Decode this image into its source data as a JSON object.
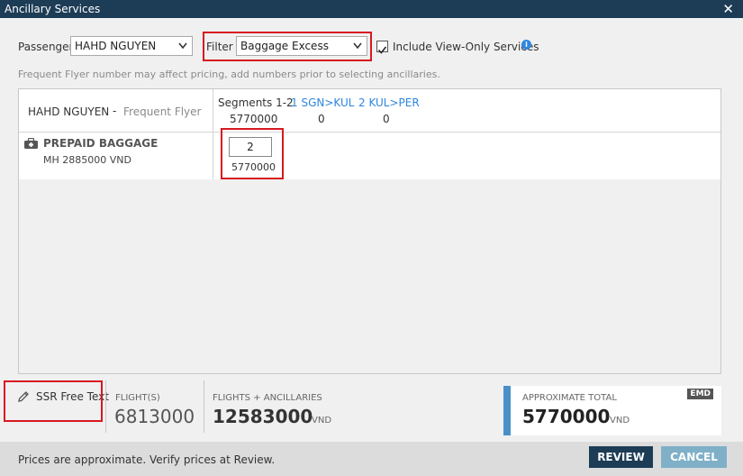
{
  "window": {
    "title": "Ancillary Services"
  },
  "toolbar": {
    "passenger_label": "Passenger",
    "passenger_value": "HAHD NGUYEN",
    "filter_label": "Filter",
    "filter_value": "Baggage Excess",
    "include_view_only_label": "Include View-Only Services",
    "include_view_only_checked": true
  },
  "note": "Frequent Flyer number may affect pricing, add numbers prior to selecting ancillaries.",
  "grid": {
    "passenger_name": "HAHD NGUYEN",
    "dash": "-",
    "frequent_flyer_label": "Frequent Flyer",
    "segments": [
      {
        "label": "Segments 1-2",
        "value": "5770000"
      },
      {
        "label": "1 SGN>KUL",
        "value": "0"
      },
      {
        "label": "2 KUL>PER",
        "value": "0"
      }
    ],
    "service": {
      "name": "PREPAID BAGGAGE",
      "price": "MH  2885000 VND",
      "quantity": "2",
      "quantity_price": "5770000"
    }
  },
  "footer": {
    "ssr_label": "SSR Free Text",
    "flights_label": "FLIGHT(S)",
    "flights_value": "6813000",
    "flights_anc_label": "FLIGHTS + ANCILLARIES",
    "flights_anc_value": "12583000",
    "flights_anc_unit": "VND",
    "approx_total_label": "APPROXIMATE TOTAL",
    "approx_total_value": "5770000",
    "approx_total_unit": "VND",
    "emd_badge": "EMD"
  },
  "status": {
    "text": "Prices are approximate. Verify prices at Review.",
    "review_label": "REVIEW",
    "cancel_label": "CANCEL"
  },
  "colors": {
    "titlebar": "#1d3c56",
    "highlight": "#d71920",
    "link": "#2e86de",
    "total_accent": "#4a90c8"
  }
}
